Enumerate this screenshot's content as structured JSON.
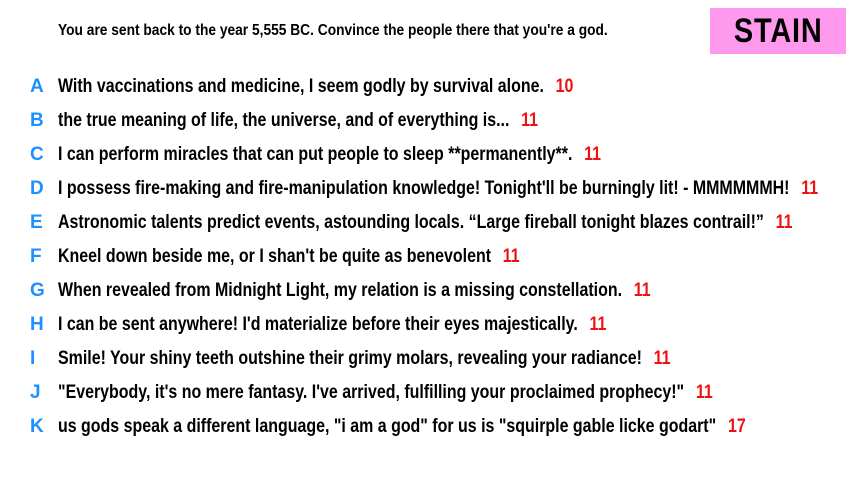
{
  "prompt": "You are sent back to the year 5,555 BC. Convince the people there that you're a god.",
  "badge": {
    "label": "STAIN",
    "color": "#ff99ee"
  },
  "colors": {
    "letter": "#1e90ff",
    "score": "#ee1111",
    "text": "#000000"
  },
  "answers": [
    {
      "letter": "A",
      "text": "With vaccinations and medicine, I seem godly by survival alone.",
      "score": "10"
    },
    {
      "letter": "B",
      "text": "the true meaning of life, the universe, and of everything is...",
      "score": "11"
    },
    {
      "letter": "C",
      "text": "I can perform miracles that can put people to sleep **permanently**.",
      "score": "11"
    },
    {
      "letter": "D",
      "text": "I possess fire-making and fire-manipulation knowledge! Tonight'll be burningly lit! - MMMMMMH!",
      "score": "11"
    },
    {
      "letter": "E",
      "text": "Astronomic talents predict events, astounding locals. “Large fireball tonight blazes contrail!”",
      "score": "11"
    },
    {
      "letter": "F",
      "text": "Kneel down beside me, or I shan't be quite as benevolent",
      "score": "11"
    },
    {
      "letter": "G",
      "text": "When revealed from Midnight Light, my relation is a missing constellation.",
      "score": "11"
    },
    {
      "letter": "H",
      "text": "I can be sent anywhere! I'd materialize before their eyes majestically.",
      "score": "11"
    },
    {
      "letter": "I",
      "text": "Smile! Your shiny teeth outshine their grimy molars, revealing your radiance!",
      "score": "11"
    },
    {
      "letter": "J",
      "text": "\"Everybody, it's no mere fantasy. I've arrived, fulfilling your proclaimed prophecy!\"",
      "score": "11"
    },
    {
      "letter": "K",
      "text": "us gods speak a different language, \"i am a god\" for us is \"squirple gable licke godart\"",
      "score": "17"
    }
  ]
}
